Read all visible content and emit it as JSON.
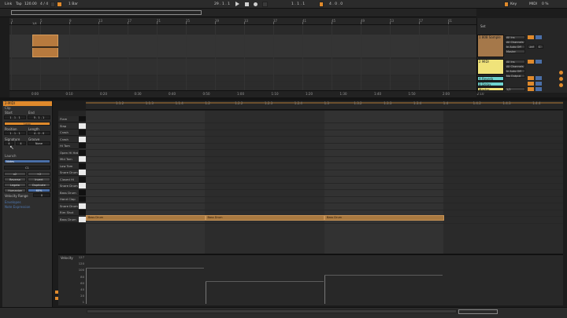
{
  "transport": {
    "link_label": "Link",
    "tap_label": "Tap",
    "tempo": "120.00",
    "time_sig": "4 / 4",
    "metronome_label": "1 Bar",
    "position": "29 . 1 . 1",
    "loop_start": "1 . 1 . 1",
    "loop_length": "4 . 0 . 0",
    "key_label": "Key",
    "midi_label": "MIDI",
    "cpu_label": "0 %"
  },
  "arrangement": {
    "clip_label": "2-MIDI",
    "clip_time": "1/4",
    "ruler_labels": [
      "1",
      "5",
      "9",
      "13",
      "17",
      "21",
      "25",
      "29",
      "33",
      "37",
      "41",
      "45",
      "49",
      "53",
      "57",
      "61",
      "65"
    ],
    "time_labels": [
      "0:00",
      "0:10",
      "0:20",
      "0:30",
      "0:40",
      "0:50",
      "1:00",
      "1:10",
      "1:20",
      "1:30",
      "1:40",
      "1:50",
      "2:00",
      "2:10"
    ]
  },
  "mixer": {
    "set_label": "Set",
    "tracks": [
      {
        "name": "1 808 Sample",
        "color": "#a5784a",
        "input": "All Ins",
        "channel": "All Channels",
        "mon": "In Auto Off",
        "out": "Master",
        "vol": "-inf",
        "pan": "C"
      },
      {
        "name": "2 MIDI",
        "color": "#f0e37a",
        "input": "All Ins",
        "channel": "All Channels",
        "mon": "In Auto Off",
        "out": "No Output"
      },
      {
        "name": "A Reverb",
        "color": "#6fd3cf"
      },
      {
        "name": "B Delay",
        "color": "#6fd3cf"
      },
      {
        "name": "Master",
        "color": "#f0e37a",
        "out": "1/2"
      }
    ]
  },
  "clip_view": {
    "header": "2-MIDI",
    "clip_section": "Clip",
    "start_label": "Start",
    "end_label": "End",
    "start_val": "1 . 1 . 1",
    "end_val": "5 . 1 . 1",
    "loop_label": "Loop",
    "position_label": "Position",
    "length_label": "Length",
    "position_val": "1 . 1 . 1",
    "length_val": "4 . 0 . 0",
    "signature_label": "Signature",
    "groove_label": "Groove",
    "sig_num": "4",
    "sig_den": "4",
    "groove_val": "None",
    "launch_label": "Launch",
    "notes_label": "Notes",
    "range_val": "C1",
    "x2": "x2",
    "half": "÷2",
    "reverse": "Reverse",
    "invert": "Invert",
    "legato": "Legato",
    "duplicate": "Duplicate",
    "humanize": "Humanize",
    "percent": "60%",
    "vel_range_label": "Velocity Range",
    "vel_range_val": "0",
    "envelopes_label": "Envelopes",
    "sample_label": "Note Expression"
  },
  "piano_roll": {
    "fold_label": "Fold",
    "scale_label": "Scale",
    "ruler_labels": [
      "1.1.2",
      "1.1.3",
      "1.1.4",
      "1.2",
      "1.2.2",
      "1.2.3",
      "1.2.4",
      "1.3",
      "1.3.2",
      "1.3.3",
      "1.3.4",
      "1.4",
      "1.4.2",
      "1.4.3",
      "1.4.4"
    ],
    "pads": [
      "Flam",
      "Slap",
      "Crash",
      "Crash",
      "Hi Tom",
      "Open Hi Hat",
      "Mid Tom",
      "Low Tom",
      "Snare Drum",
      "Closed Hi Hat",
      "Snare Drum",
      "Bass Drum",
      "Hand Clap",
      "Snare Drum",
      "Rim Shot",
      "Bass Drum"
    ],
    "notes": [
      {
        "label": "Bass Drum",
        "start": 0,
        "length": 1
      },
      {
        "label": "Bass Drum",
        "start": 1,
        "length": 1
      },
      {
        "label": "Bass Drum",
        "start": 2,
        "length": 1
      }
    ]
  },
  "velocity": {
    "title": "Velocity",
    "ticks": [
      "127",
      "120",
      "100",
      "80",
      "60",
      "40",
      "20",
      "1"
    ],
    "values": [
      100,
      64,
      82
    ]
  }
}
